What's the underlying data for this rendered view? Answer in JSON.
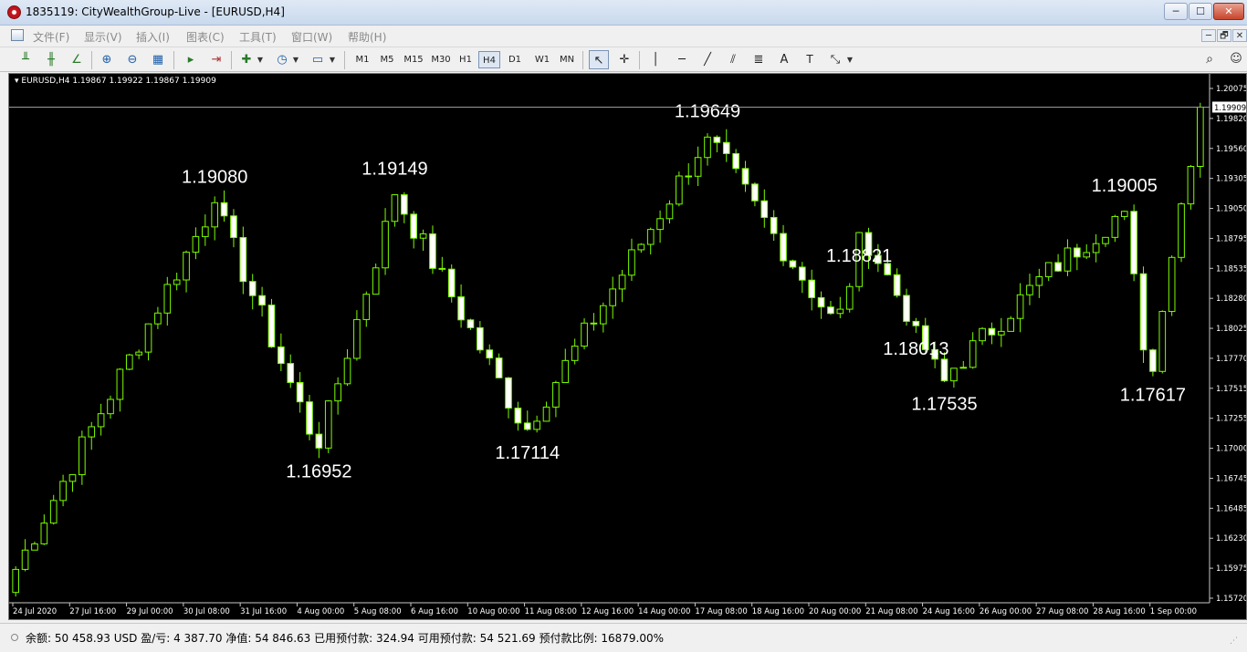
{
  "window": {
    "title": "1835119: CityWealthGroup-Live - [EURUSD,H4]",
    "min_label": "─",
    "max_label": "☐",
    "close_label": "✕"
  },
  "menu": [
    "文件(F)",
    "显示(V)",
    "插入(I)",
    "图表(C)",
    "工具(T)",
    "窗口(W)",
    "帮助(H)"
  ],
  "mdi_controls": [
    "─",
    "🗗",
    "✕"
  ],
  "toolbar": {
    "timeframes": [
      "M1",
      "M5",
      "M15",
      "M30",
      "H1",
      "H4",
      "D1",
      "W1",
      "MN"
    ],
    "active_timeframe": "H4",
    "text_tool": "A",
    "label_tool": "T"
  },
  "chart_data": {
    "type": "candlestick",
    "symbol_info": "EURUSD,H4  1.19867 1.19922 1.19867 1.19909",
    "current_price": "1.19909",
    "ylim": [
      1.1565,
      1.2015
    ],
    "y_ticks": [
      "1.20075",
      "1.19820",
      "1.19560",
      "1.19305",
      "1.19050",
      "1.18795",
      "1.18535",
      "1.18280",
      "1.18025",
      "1.17770",
      "1.17515",
      "1.17255",
      "1.17000",
      "1.16745",
      "1.16485",
      "1.16230",
      "1.15975",
      "1.15720"
    ],
    "x_labels": [
      "24 Jul 2020",
      "27 Jul 16:00",
      "29 Jul 00:00",
      "30 Jul 08:00",
      "31 Jul 16:00",
      "4 Aug 00:00",
      "5 Aug 08:00",
      "6 Aug 16:00",
      "10 Aug 00:00",
      "11 Aug 08:00",
      "12 Aug 16:00",
      "14 Aug 00:00",
      "17 Aug 08:00",
      "18 Aug 16:00",
      "20 Aug 00:00",
      "21 Aug 08:00",
      "24 Aug 16:00",
      "26 Aug 00:00",
      "27 Aug 08:00",
      "28 Aug 16:00",
      "1 Sep 00:00"
    ],
    "annotations": [
      "1.19080",
      "1.16952",
      "1.19149",
      "1.17114",
      "1.19649",
      "1.18821",
      "1.18013",
      "1.17535",
      "1.19005",
      "1.17617"
    ],
    "annotation_indices": [
      8,
      12,
      15,
      20,
      27,
      33,
      35,
      36,
      43,
      44
    ],
    "anchor_indices": [
      0,
      8,
      12,
      15,
      20,
      27,
      32,
      33,
      35,
      36,
      40,
      43,
      44,
      46
    ],
    "anchor_prices": [
      1.1575,
      1.1908,
      1.16952,
      1.19149,
      1.17114,
      1.19649,
      1.18,
      1.18821,
      1.18013,
      1.17535,
      1.1845,
      1.19005,
      1.17617,
      1.19909
    ],
    "candles_per_day": 6,
    "bullish_color": "#000000",
    "bearish_color": "#ffffff",
    "wick_color": "#7cfc00",
    "background": "#000000",
    "grid": false
  },
  "status": {
    "text": "余额: 50 458.93 USD   盈/亏: 4 387.70   净值: 54 846.63   已用预付款: 324.94   可用预付款: 54 521.69   预付款比例: 16879.00%"
  }
}
